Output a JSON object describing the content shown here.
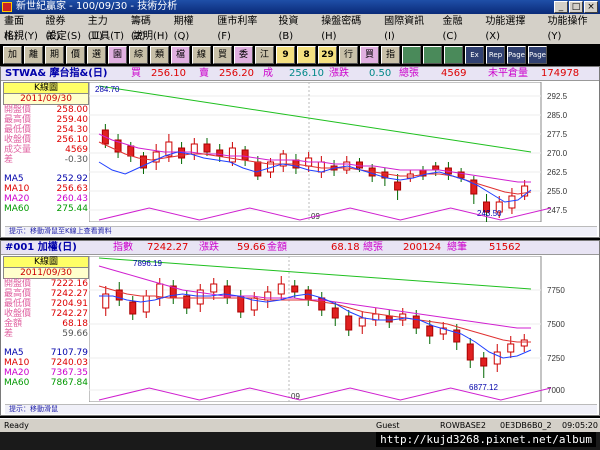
{
  "window": {
    "title": "新世紀贏家 - 100/09/30 - 技術分析"
  },
  "menu": {
    "row1": [
      "畫面(L)",
      "證券(E)",
      "主力(U)",
      "籌碼(Z)",
      "期權(Q)",
      "匯市利率(F)",
      "投資(B)",
      "操盤密碼(H)",
      "國際資訊(I)",
      "金融(C)",
      "功能選擇(X)",
      "功能操作(Y)"
    ],
    "row2": [
      "格視(Y)",
      "設定(S)",
      "工具(T)",
      "說明(H)"
    ]
  },
  "toolbar": [
    "加",
    "離",
    "期",
    "價",
    "選",
    "園",
    "綜",
    "類",
    "檔",
    "線",
    "貿",
    "委",
    "江",
    "9",
    "8",
    "29",
    "行",
    "買",
    "指",
    "",
    "",
    "",
    "Ex",
    "Rep",
    "Page",
    "Page"
  ],
  "top": {
    "header": {
      "code": "STWA& 摩台指&(日)",
      "buy_lbl": "買",
      "buy": "256.10",
      "sell_lbl": "賣",
      "sell": "256.20",
      "deal_lbl": "成",
      "deal": "256.10",
      "chg_lbl": "漲跌",
      "chg": "0.50",
      "vol_lbl": "總張",
      "vol": "4569",
      "oi_lbl": "未平倉量",
      "oi": "174978"
    },
    "info": {
      "k_label": "K線圖",
      "date": "2011/09/30",
      "rows": [
        {
          "label": "開盤價",
          "value": "258.00"
        },
        {
          "label": "最高價",
          "value": "259.40"
        },
        {
          "label": "最低價",
          "value": "254.30"
        },
        {
          "label": "收盤價",
          "value": "256.10"
        },
        {
          "label": "成交量",
          "value": "4569"
        },
        {
          "label": "差",
          "value": "-0.30"
        }
      ],
      "ma": [
        {
          "label": "MA5",
          "value": "252.92"
        },
        {
          "label": "MA10",
          "value": "256.63"
        },
        {
          "label": "MA20",
          "value": "260.43"
        },
        {
          "label": "MA60",
          "value": "275.44"
        }
      ]
    },
    "status": "提示：移動滑鼠至K線上查看資料",
    "annotations": {
      "high": "284.70",
      "low": "243.50",
      "month": "09"
    },
    "yticks": [
      "292.5",
      "285.0",
      "277.5",
      "270.0",
      "262.5",
      "255.0",
      "247.5",
      "240.0"
    ]
  },
  "bottom": {
    "header": {
      "code": "#001 加權(日)",
      "idx_lbl": "指數",
      "idx": "7242.27",
      "chg_lbl": "漲跌",
      "chg": "59.66",
      "amt_lbl": "金額",
      "amt": "68.18",
      "vol_lbl": "總張",
      "vol": "200124",
      "cnt_lbl": "總筆",
      "cnt": "51562"
    },
    "info": {
      "k_label": "K線圖",
      "date": "2011/09/30",
      "rows": [
        {
          "label": "開盤價",
          "value": "7222.16"
        },
        {
          "label": "最高價",
          "value": "7242.27"
        },
        {
          "label": "最低價",
          "value": "7204.91"
        },
        {
          "label": "收盤價",
          "value": "7242.27"
        },
        {
          "label": "金額",
          "value": "68.18"
        },
        {
          "label": "差",
          "value": "59.66"
        }
      ],
      "ma": [
        {
          "label": "MA5",
          "value": "7107.79"
        },
        {
          "label": "MA10",
          "value": "7240.03"
        },
        {
          "label": "MA20",
          "value": "7367.35"
        },
        {
          "label": "MA60",
          "value": "7867.84"
        }
      ]
    },
    "status": "提示：移動滑鼠",
    "annotations": {
      "high": "7896.19",
      "low": "6877.12",
      "month": "09"
    },
    "yticks": [
      "7750",
      "7500",
      "7250",
      "7000"
    ]
  },
  "statusbar": {
    "ready": "Ready",
    "user": "Guest",
    "server": "ROWBASE2",
    "id": "0E3DB6B0_2",
    "time": "09:05:20"
  },
  "watermark": "http://kujd3268.pixnet.net/album",
  "colors": {
    "up": "#e02020",
    "down": "#30c0e0",
    "ma5": "#2040ff",
    "ma10": "#e03030",
    "ma20": "#d020d0",
    "ma60": "#20c020"
  }
}
